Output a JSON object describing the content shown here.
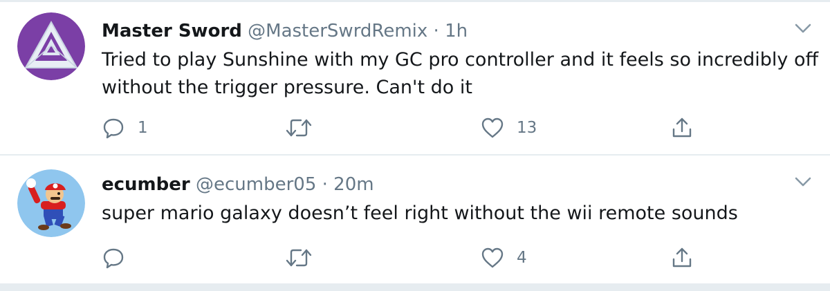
{
  "tweets": [
    {
      "name": "Master Sword",
      "handle": "@MasterSwrdRemix",
      "separator": "·",
      "time": "1h",
      "text": "Tried to play Sunshine with my GC pro controller and it feels so incredibly off without the trigger pressure. Can't do it",
      "replies": "1",
      "retweets": "",
      "likes": "13",
      "avatar_icon": "triforce-avatar-icon"
    },
    {
      "name": "ecumber",
      "handle": "@ecumber05",
      "separator": "·",
      "time": "20m",
      "text": "super mario galaxy doesn’t feel right without the wii remote sounds",
      "replies": "",
      "retweets": "",
      "likes": "4",
      "avatar_icon": "mario-avatar-icon"
    }
  ],
  "colors": {
    "text": "#14171a",
    "secondary": "#657786",
    "divider": "#e6ecf0",
    "avatar1_bg": "#7b3fa6",
    "avatar2_bg": "#8fc6ee"
  }
}
